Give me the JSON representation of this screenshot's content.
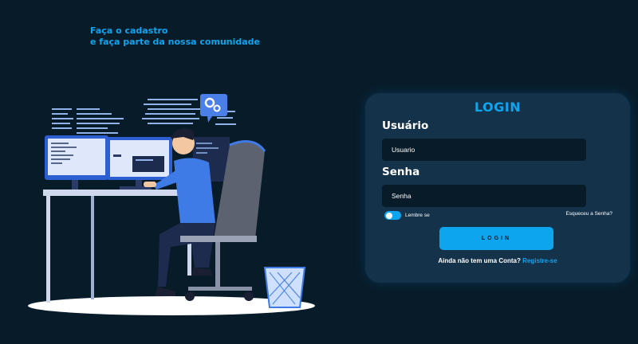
{
  "tagline": {
    "line1": "Faça o cadastro",
    "line2": "e faça parte da nossa comunidade"
  },
  "login": {
    "title": "LOGIN",
    "username_label": "Usuário",
    "username_placeholder": "Usuario",
    "password_label": "Senha",
    "password_placeholder": "Senha",
    "remember_label": "Lembre se",
    "remember_on": true,
    "forgot_label": "Esqueceu a Senha?",
    "button_label": "LOGIN",
    "signup_prompt": "Ainda não tem uma Conta?",
    "signup_link": "Registre-se"
  },
  "colors": {
    "background": "#081b29",
    "card": "#14324a",
    "accent": "#0ea5ef"
  },
  "illustration": {
    "icon": "developer-at-desk-illustration"
  }
}
